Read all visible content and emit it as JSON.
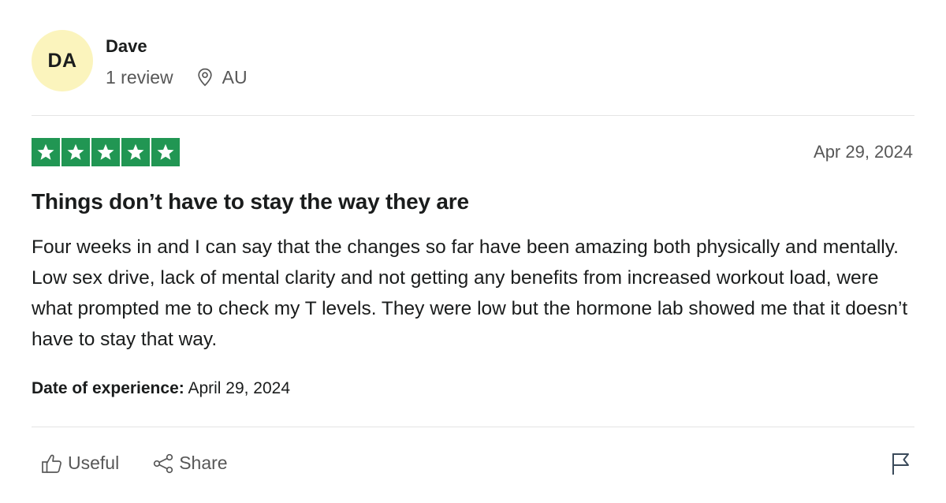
{
  "reviewer": {
    "initials": "DA",
    "name": "Dave",
    "review_count": "1 review",
    "country": "AU",
    "avatar_bg": "#fbf4bd",
    "location_icon": "location-pin-icon"
  },
  "review": {
    "rating": 5,
    "rating_max": 5,
    "star_color": "#219653",
    "date": "Apr 29, 2024",
    "title": "Things don’t have to stay the way they are",
    "body": "Four weeks in and I can say that the changes so far have been amazing both physically and mentally. Low sex drive, lack of mental clarity and not getting any benefits from increased workout load, were what prompted me to check my T levels. They were low but the hormone lab showed me that it doesn’t have to stay that way.",
    "experience_label": "Date of experience:",
    "experience_date": "April 29, 2024"
  },
  "actions": {
    "useful_label": "Useful",
    "useful_icon": "thumbs-up-icon",
    "share_label": "Share",
    "share_icon": "share-icon",
    "report_icon": "flag-icon"
  }
}
